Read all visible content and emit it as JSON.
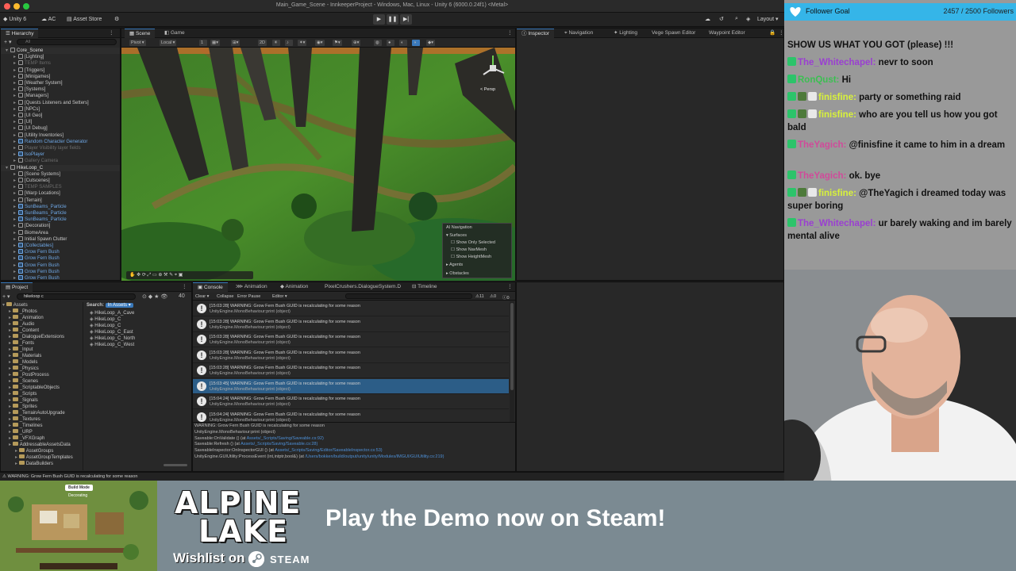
{
  "unity": {
    "window_title": "Main_Game_Scene - InnkeeperProject - Windows, Mac, Linux - Unity 6 (6000.0.24f1) <Metal>",
    "toolbar": {
      "account": "Unity 6",
      "ac": "AC",
      "asset_store": "Asset Store",
      "layout": "Layout"
    },
    "hierarchy": {
      "tab": "Hierarchy",
      "search_placeholder": "All",
      "items": [
        {
          "label": "Core_Scene",
          "depth": 0,
          "style": "root"
        },
        {
          "label": "[Lighting]",
          "depth": 1,
          "style": ""
        },
        {
          "label": "TEMP Items",
          "depth": 1,
          "style": "dim"
        },
        {
          "label": "[Triggers]",
          "depth": 1,
          "style": ""
        },
        {
          "label": "[Minigames]",
          "depth": 1,
          "style": ""
        },
        {
          "label": "[Weather System]",
          "depth": 1,
          "style": ""
        },
        {
          "label": "[Systems]",
          "depth": 1,
          "style": ""
        },
        {
          "label": "[Managers]",
          "depth": 1,
          "style": ""
        },
        {
          "label": "[Quests Listeners and Setters]",
          "depth": 1,
          "style": ""
        },
        {
          "label": "[NPCs]",
          "depth": 1,
          "style": ""
        },
        {
          "label": "[UI Geo]",
          "depth": 1,
          "style": ""
        },
        {
          "label": "[UI]",
          "depth": 1,
          "style": ""
        },
        {
          "label": "[UI Debug]",
          "depth": 1,
          "style": ""
        },
        {
          "label": "[Utility Inventories]",
          "depth": 1,
          "style": ""
        },
        {
          "label": "Random Character Generator",
          "depth": 1,
          "style": "blue"
        },
        {
          "label": "Player Visibility layer fields",
          "depth": 1,
          "style": "dim"
        },
        {
          "label": "IsoPlayer",
          "depth": 1,
          "style": "blue"
        },
        {
          "label": "Gallery Camera",
          "depth": 1,
          "style": "dim"
        },
        {
          "label": "HikeLoop_C",
          "depth": 0,
          "style": "root"
        },
        {
          "label": "[Scene Systems]",
          "depth": 1,
          "style": ""
        },
        {
          "label": "[Cutscenes]",
          "depth": 1,
          "style": ""
        },
        {
          "label": "TEMP SAMPLES",
          "depth": 1,
          "style": "dim"
        },
        {
          "label": "[Warp Locations]",
          "depth": 1,
          "style": ""
        },
        {
          "label": "[Terrain]",
          "depth": 1,
          "style": ""
        },
        {
          "label": "SunBeams_Particle",
          "depth": 1,
          "style": "blue"
        },
        {
          "label": "SunBeams_Particle",
          "depth": 1,
          "style": "blue"
        },
        {
          "label": "SunBeams_Particle",
          "depth": 1,
          "style": "blue"
        },
        {
          "label": "[Decoration]",
          "depth": 1,
          "style": ""
        },
        {
          "label": "BiomeArea",
          "depth": 1,
          "style": ""
        },
        {
          "label": "Initial Spawn Clutter",
          "depth": 1,
          "style": ""
        },
        {
          "label": "[Collectables]",
          "depth": 1,
          "style": "blue"
        },
        {
          "label": "Grow Fern Bush",
          "depth": 1,
          "style": "blue"
        },
        {
          "label": "Grow Fern Bush",
          "depth": 1,
          "style": "blue"
        },
        {
          "label": "Grow Fern Bush",
          "depth": 1,
          "style": "blue"
        },
        {
          "label": "Grow Fern Bush",
          "depth": 1,
          "style": "blue"
        },
        {
          "label": "Grow Fern Bush",
          "depth": 1,
          "style": "blue"
        }
      ]
    },
    "scene": {
      "tabs": [
        "Scene",
        "Game"
      ],
      "pivot": "Pivot",
      "local": "Local",
      "mode_2d": "2D",
      "persp": "< Persp",
      "ai_nav": {
        "title": "AI Navigation",
        "items": [
          "Surfaces",
          "Show Only Selected",
          "Show NavMesh",
          "Show HeightMesh",
          "Agents",
          "Obstacles"
        ]
      }
    },
    "inspector": {
      "tabs": [
        "Inspector",
        "Navigation",
        "Lighting",
        "Vege Spawn Editor",
        "Waypoint Editor"
      ]
    },
    "project": {
      "tab": "Project",
      "search_value": "hikeloop c",
      "search_label": "Search:",
      "search_scope": "In Assets",
      "count": "40",
      "folders": [
        {
          "label": "Assets",
          "depth": 0
        },
        {
          "label": "_Photos",
          "depth": 1
        },
        {
          "label": "_Animation",
          "depth": 1
        },
        {
          "label": "_Audio",
          "depth": 1
        },
        {
          "label": "_Content",
          "depth": 1
        },
        {
          "label": "_DialogueExtensions",
          "depth": 1
        },
        {
          "label": "_Fonts",
          "depth": 1
        },
        {
          "label": "_Input",
          "depth": 1
        },
        {
          "label": "_Materials",
          "depth": 1
        },
        {
          "label": "_Models",
          "depth": 1
        },
        {
          "label": "_Physics",
          "depth": 1
        },
        {
          "label": "_PostProcess",
          "depth": 1
        },
        {
          "label": "_Scenes",
          "depth": 1
        },
        {
          "label": "_ScriptableObjects",
          "depth": 1
        },
        {
          "label": "_Scripts",
          "depth": 1
        },
        {
          "label": "_Signals",
          "depth": 1
        },
        {
          "label": "_Sprites",
          "depth": 1
        },
        {
          "label": "_TerrainAutoUpgrade",
          "depth": 1
        },
        {
          "label": "_Textures",
          "depth": 1
        },
        {
          "label": "_Timelines",
          "depth": 1
        },
        {
          "label": "_URP",
          "depth": 1
        },
        {
          "label": "_VFXGraph",
          "depth": 1
        },
        {
          "label": "AddressableAssetsData",
          "depth": 1
        },
        {
          "label": "AssetGroups",
          "depth": 2
        },
        {
          "label": "AssetGroupTemplates",
          "depth": 2
        },
        {
          "label": "DataBuilders",
          "depth": 2
        }
      ],
      "results": [
        "HikeLoop_A_Cave",
        "HikeLoop_C",
        "HikeLoop_C",
        "HikeLoop_C_East",
        "HikeLoop_C_North",
        "HikeLoop_C_West"
      ]
    },
    "console": {
      "tabs": [
        "Console",
        "Animation",
        "Animation",
        "PixelCrushers.DialogueSystem.D",
        "Timeline"
      ],
      "buttons": [
        "Clear",
        "Collapse",
        "Error Pause",
        "Editor"
      ],
      "count_warn": "11",
      "count_err": "0",
      "count_info": "0",
      "logs": [
        {
          "time": "[15:03:28]",
          "msg": "WARNING: Grow Fern Bush GUID is recalculating for some reason",
          "sub": "UnityEngine.MonoBehaviour:print (object)",
          "selected": false
        },
        {
          "time": "[15:03:28]",
          "msg": "WARNING: Grow Fern Bush GUID is recalculating for some reason",
          "sub": "UnityEngine.MonoBehaviour:print (object)",
          "selected": false
        },
        {
          "time": "[15:03:28]",
          "msg": "WARNING: Grow Fern Bush GUID is recalculating for some reason",
          "sub": "UnityEngine.MonoBehaviour:print (object)",
          "selected": false
        },
        {
          "time": "[15:03:28]",
          "msg": "WARNING: Grow Fern Bush GUID is recalculating for some reason",
          "sub": "UnityEngine.MonoBehaviour:print (object)",
          "selected": false
        },
        {
          "time": "[15:03:28]",
          "msg": "WARNING: Grow Fern Bush GUID is recalculating for some reason",
          "sub": "UnityEngine.MonoBehaviour:print (object)",
          "selected": false
        },
        {
          "time": "[15:03:45]",
          "msg": "WARNING: Grow Fern Bush GUID is recalculating for some reason",
          "sub": "UnityEngine.MonoBehaviour:print (object)",
          "selected": true
        },
        {
          "time": "[15:04:24]",
          "msg": "WARNING: Grow Fern Bush GUID is recalculating for some reason",
          "sub": "UnityEngine.MonoBehaviour:print (object)",
          "selected": false
        },
        {
          "time": "[15:04:24]",
          "msg": "WARNING: Grow Fern Bush GUID is recalculating for some reason",
          "sub": "UnityEngine.MonoBehaviour:print (object)",
          "selected": false
        }
      ],
      "stack": [
        {
          "text": "WARNING: Grow Fern Bush GUID is recalculating for some reason",
          "link": ""
        },
        {
          "text": "UnityEngine.MonoBehaviour:print (object)",
          "link": ""
        },
        {
          "text": "Saveable:OnValidate () (at ",
          "link": "Assets/_Scripts/Saving/Saveable.cs:92)"
        },
        {
          "text": "Saveable:Refresh () (at ",
          "link": "Assets/_Scripts/Saving/Saveable.cs:28)"
        },
        {
          "text": "SaveableInspector:OnInspectorGUI () (at ",
          "link": "Assets/_Scripts/Saving/Editor/SaveableInspector.cs:53)"
        },
        {
          "text": "UnityEngine.GUIUtility:ProcessEvent (int,intptr,bool&) (at ",
          "link": "/Users/bokken/build/output/unity/unity/Modules/IMGUI/GUIUtility.cs:219)"
        }
      ]
    },
    "status": "WARNING: Grow Fern Bush GUID is recalculating for some reason"
  },
  "stream": {
    "goal": {
      "label": "Follower Goal",
      "value": "2457 / 2500 Followers",
      "current": 2457,
      "target": 2500
    },
    "chat": [
      {
        "user": "",
        "text": "SHOW US WHAT YOU GOT (please) !!!",
        "color": "#111111",
        "badges": 0
      },
      {
        "user": "The_Whitechapel:",
        "text": "nevr to soon",
        "color": "#9a3fd1",
        "badges": 1
      },
      {
        "user": "RonQust:",
        "text": "Hi",
        "color": "#3cbf52",
        "badges": 1
      },
      {
        "user": "finisfine:",
        "text": "party or something raid",
        "color": "#d8f23a",
        "badges": 3
      },
      {
        "user": "finisfine:",
        "text": "who are you tell us how you got bald",
        "color": "#d8f23a",
        "badges": 3
      },
      {
        "user": "TheYagich:",
        "text": "@finisfine it came to him in a dream",
        "color": "#d14a9a",
        "badges": 1
      },
      {
        "user": "TheYagich:",
        "text": "ok. bye",
        "color": "#d14a9a",
        "badges": 1
      },
      {
        "user": "finisfine:",
        "text": "@TheYagich i dreamed today was super boring",
        "color": "#d8f23a",
        "badges": 3
      },
      {
        "user": "The_Whitechapel:",
        "text": "ur barely waking and im barely mental alive",
        "color": "#9a3fd1",
        "badges": 1
      }
    ],
    "banner": {
      "logo_line1": "ALPINE",
      "logo_line2": "LAKE",
      "wishlist": "Wishlist on",
      "steam": "STEAM",
      "cta": "Play the Demo now on Steam!",
      "thumb_label": "Build Mode",
      "thumb_sub": "Decorating"
    }
  },
  "colors": {
    "accent": "#3a79bb",
    "goal_bar": "#35b5e8",
    "warning_select": "#2c5d87"
  }
}
